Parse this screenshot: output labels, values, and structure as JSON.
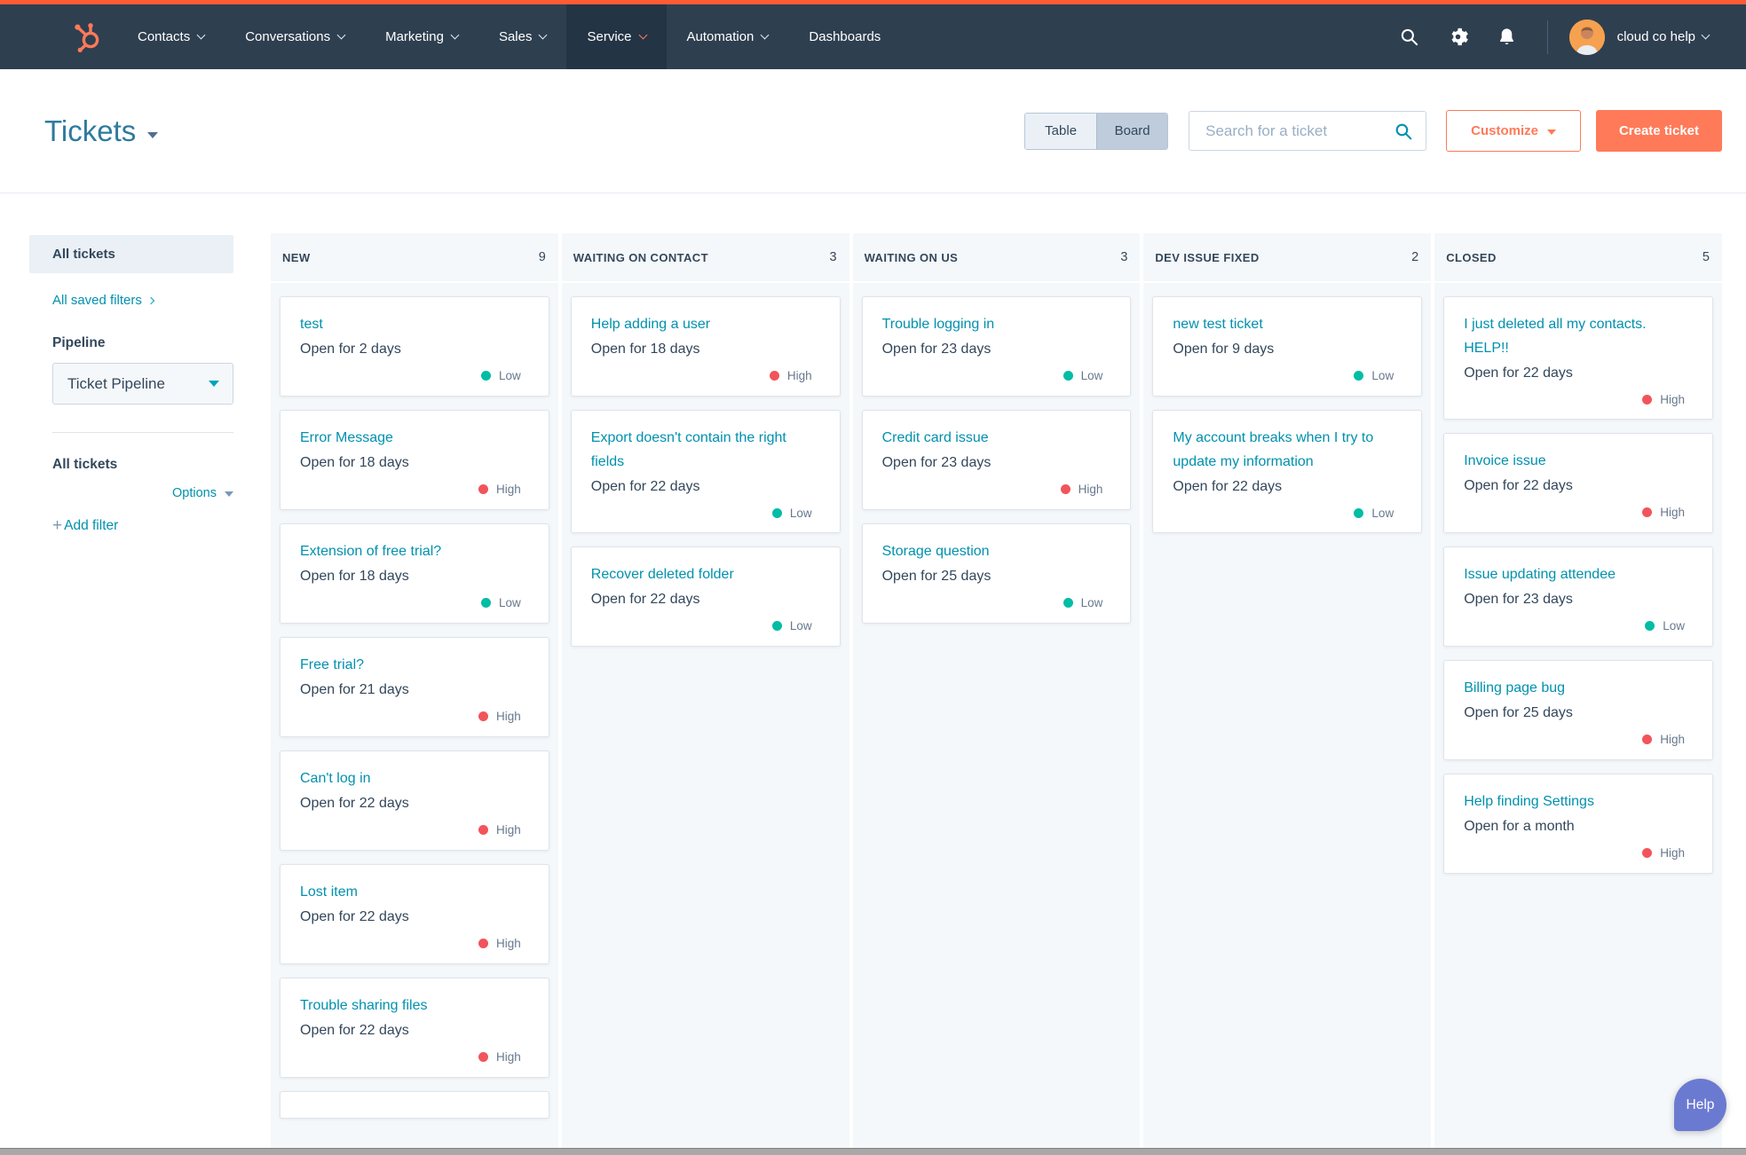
{
  "nav": {
    "logo": "hubspot-sprocket-icon",
    "items": [
      {
        "label": "Contacts",
        "caret": true,
        "active": false
      },
      {
        "label": "Conversations",
        "caret": true,
        "active": false
      },
      {
        "label": "Marketing",
        "caret": true,
        "active": false
      },
      {
        "label": "Sales",
        "caret": true,
        "active": false
      },
      {
        "label": "Service",
        "caret": true,
        "active": true
      },
      {
        "label": "Automation",
        "caret": true,
        "active": false
      },
      {
        "label": "Dashboards",
        "caret": false,
        "active": false
      }
    ],
    "icons": [
      "search-icon",
      "settings-gear-icon",
      "notifications-bell-icon"
    ],
    "account": "cloud co help"
  },
  "header": {
    "title": "Tickets",
    "view_toggle": {
      "table": "Table",
      "board": "Board",
      "selected": "Board"
    },
    "search_placeholder": "Search for a ticket",
    "customize_label": "Customize",
    "create_label": "Create ticket"
  },
  "sidebar": {
    "all_tickets": "All tickets",
    "saved_filters": "All saved filters",
    "pipeline_label": "Pipeline",
    "pipeline_value": "Ticket Pipeline",
    "filter_title": "All tickets",
    "options_label": "Options",
    "add_filter_plus": "+",
    "add_filter": "Add filter"
  },
  "board": {
    "columns": [
      {
        "name": "NEW",
        "count": "9",
        "partial_card": true,
        "cards": [
          {
            "title": "test",
            "meta": "Open for 2 days",
            "priority": "Low"
          },
          {
            "title": "Error Message",
            "meta": "Open for 18 days",
            "priority": "High"
          },
          {
            "title": "Extension of free trial?",
            "meta": "Open for 18 days",
            "priority": "Low"
          },
          {
            "title": "Free trial?",
            "meta": "Open for 21 days",
            "priority": "High"
          },
          {
            "title": "Can't log in",
            "meta": "Open for 22 days",
            "priority": "High"
          },
          {
            "title": "Lost item",
            "meta": "Open for 22 days",
            "priority": "High"
          },
          {
            "title": "Trouble sharing files",
            "meta": "Open for 22 days",
            "priority": "High"
          }
        ]
      },
      {
        "name": "WAITING ON CONTACT",
        "count": "3",
        "partial_card": false,
        "cards": [
          {
            "title": "Help adding a user",
            "meta": "Open for 18 days",
            "priority": "High"
          },
          {
            "title": "Export doesn't contain the right fields",
            "meta": "Open for 22 days",
            "priority": "Low"
          },
          {
            "title": "Recover deleted folder",
            "meta": "Open for 22 days",
            "priority": "Low"
          }
        ]
      },
      {
        "name": "WAITING ON US",
        "count": "3",
        "partial_card": false,
        "cards": [
          {
            "title": "Trouble logging in",
            "meta": "Open for 23 days",
            "priority": "Low"
          },
          {
            "title": "Credit card issue",
            "meta": "Open for 23 days",
            "priority": "High"
          },
          {
            "title": "Storage question",
            "meta": "Open for 25 days",
            "priority": "Low"
          }
        ]
      },
      {
        "name": "DEV ISSUE FIXED",
        "count": "2",
        "partial_card": false,
        "cards": [
          {
            "title": "new test ticket",
            "meta": "Open for 9 days",
            "priority": "Low"
          },
          {
            "title": "My account breaks when I try to update my information",
            "meta": "Open for 22 days",
            "priority": "Low"
          }
        ]
      },
      {
        "name": "CLOSED",
        "count": "5",
        "partial_card": false,
        "cards": [
          {
            "title": "I just deleted all my contacts. HELP!!",
            "meta": "Open for 22 days",
            "priority": "High"
          },
          {
            "title": "Invoice issue",
            "meta": "Open for 22 days",
            "priority": "High"
          },
          {
            "title": "Issue updating attendee",
            "meta": "Open for 23 days",
            "priority": "Low"
          },
          {
            "title": "Billing page bug",
            "meta": "Open for 25 days",
            "priority": "High"
          },
          {
            "title": "Help finding Settings",
            "meta": "Open for a month",
            "priority": "High"
          }
        ]
      }
    ]
  },
  "help_label": "Help",
  "colors": {
    "top_strip": "#ff5c35",
    "nav_bg": "#2e3f50",
    "brand_orange": "#ff7a59",
    "link_teal": "#0091ae",
    "priority_low": "#00bda5",
    "priority_high": "#f2545b",
    "text_dark": "#33475b",
    "column_bg": "#f5f8fa",
    "help_purple": "#6b7ad1"
  }
}
